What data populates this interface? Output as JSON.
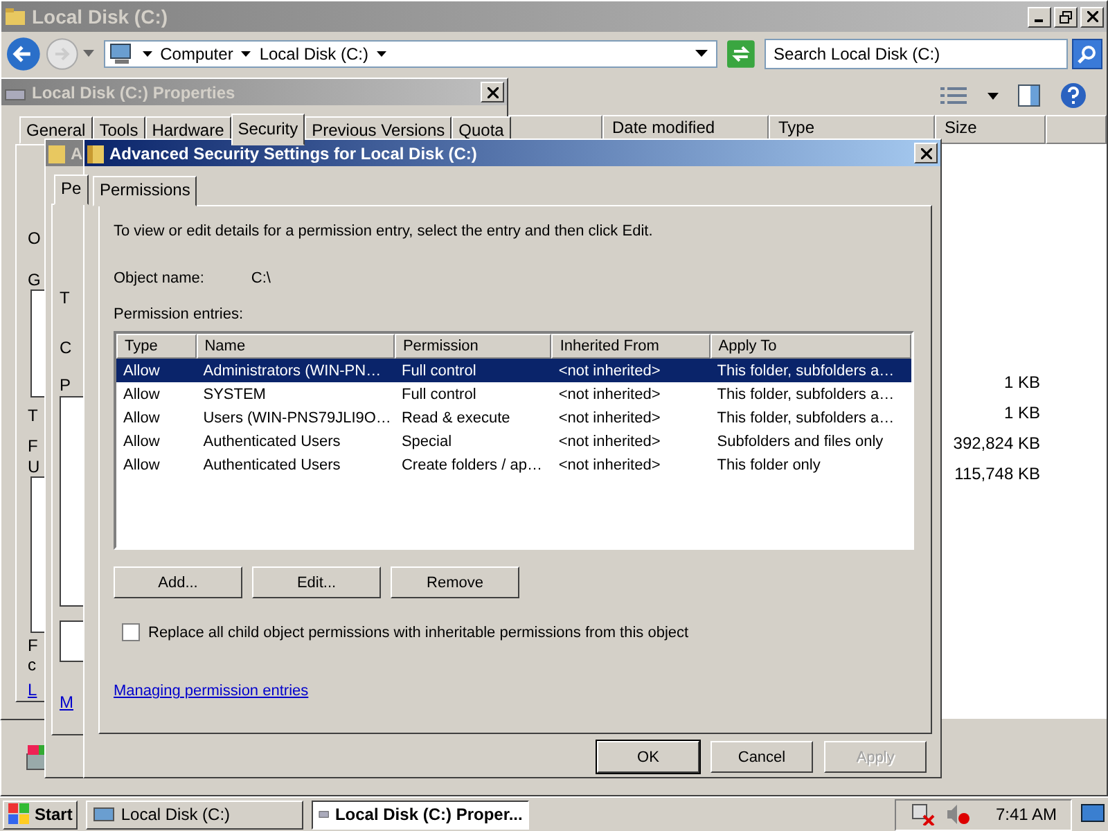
{
  "explorer": {
    "title": "Local Disk (C:)",
    "breadcrumb": [
      "Computer",
      "Local Disk (C:)"
    ],
    "search": {
      "placeholder": "Search Local Disk (C:)"
    },
    "columns": [
      "Date modified",
      "Type",
      "Size"
    ],
    "sizes": [
      "1 KB",
      "1 KB",
      "392,824 KB",
      "115,748 KB"
    ]
  },
  "properties_dialog": {
    "title": "Local Disk (C:) Properties",
    "tabs": [
      {
        "label": "General",
        "selected": false
      },
      {
        "label": "Tools",
        "selected": false
      },
      {
        "label": "Hardware",
        "selected": false
      },
      {
        "label": "Security",
        "selected": true
      },
      {
        "label": "Previous Versions",
        "selected": false
      },
      {
        "label": "Quota",
        "selected": false
      }
    ],
    "fragments": [
      "O",
      "G",
      "T",
      "F",
      "U",
      "F",
      "c"
    ],
    "link": "L"
  },
  "behind_dialog": {
    "title": "A",
    "tab": "Pe",
    "fragments": [
      "T",
      "C",
      "P"
    ],
    "link": "M"
  },
  "security_dialog": {
    "title": "Advanced Security Settings for Local Disk (C:)",
    "tab": "Permissions",
    "intro": "To view or edit details for a permission entry, select the entry and then click Edit.",
    "object_label": "Object name:",
    "object_value": "C:\\",
    "entries_label": "Permission entries:",
    "columns": [
      "Type",
      "Name",
      "Permission",
      "Inherited From",
      "Apply To"
    ],
    "rows": [
      {
        "cells": [
          "Allow",
          "Administrators (WIN-PN…",
          "Full control",
          "<not inherited>",
          "This folder, subfolders a…"
        ],
        "selected": true
      },
      {
        "cells": [
          "Allow",
          "SYSTEM",
          "Full control",
          "<not inherited>",
          "This folder, subfolders a…"
        ],
        "selected": false
      },
      {
        "cells": [
          "Allow",
          "Users (WIN-PNS79JLI9O…",
          "Read & execute",
          "<not inherited>",
          "This folder, subfolders a…"
        ],
        "selected": false
      },
      {
        "cells": [
          "Allow",
          "Authenticated Users",
          "Special",
          "<not inherited>",
          "Subfolders and files only"
        ],
        "selected": false
      },
      {
        "cells": [
          "Allow",
          "Authenticated Users",
          "Create folders / ap…",
          "<not inherited>",
          "This folder only"
        ],
        "selected": false
      }
    ],
    "entry_buttons": [
      "Add...",
      "Edit...",
      "Remove"
    ],
    "replace_checkbox": {
      "label": "Replace all child object permissions with inheritable permissions from this object",
      "checked": false
    },
    "link": "Managing permission entries",
    "buttons": [
      {
        "label": "OK",
        "disabled": false
      },
      {
        "label": "Cancel",
        "disabled": false
      },
      {
        "label": "Apply",
        "disabled": true
      }
    ]
  },
  "taskbar": {
    "start": "Start",
    "tasks": [
      {
        "label": "Local Disk (C:)",
        "selected": false
      },
      {
        "label": "Local Disk (C:) Proper...",
        "selected": true
      }
    ],
    "clock": "7:41 AM"
  }
}
